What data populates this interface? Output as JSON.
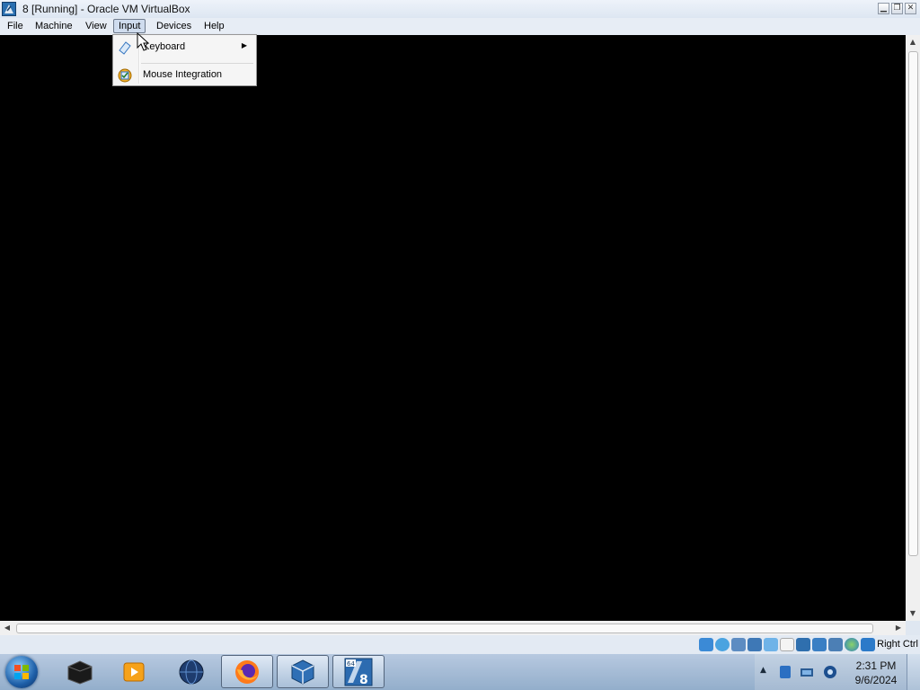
{
  "window": {
    "title": "8 [Running] - Oracle VM VirtualBox",
    "minimize_glyph": "▁",
    "restore_glyph": "❐",
    "close_glyph": "✕"
  },
  "menubar": {
    "items": [
      {
        "label": "File"
      },
      {
        "label": "Machine"
      },
      {
        "label": "View"
      },
      {
        "label": "Input",
        "active": true
      },
      {
        "label": "Devices"
      },
      {
        "label": "Help"
      }
    ]
  },
  "input_menu": {
    "items": [
      {
        "label": "Keyboard",
        "icon": "keyboard-icon",
        "has_submenu": true,
        "submenu_glyph": "▶"
      },
      {
        "label": "Mouse Integration",
        "icon": "mouse-integration-icon",
        "has_submenu": false
      }
    ]
  },
  "statusbar": {
    "host_key": "Right Ctrl",
    "icons": [
      "hard-disk-icon",
      "optical-drive-icon",
      "audio-icon",
      "network-icon",
      "usb-icon",
      "shared-folders-icon",
      "display-icon",
      "video-capture-icon",
      "cpu-icon",
      "mouse-integration-icon",
      "host-key-icon"
    ]
  },
  "scroll_glyphs": {
    "up": "▲",
    "down": "▼",
    "left": "◀",
    "right": "▶"
  },
  "taskbar": {
    "apps": [
      "start-button",
      "taskbar-app-explorer-dark",
      "taskbar-app-media",
      "taskbar-app-globe",
      "taskbar-app-firefox",
      "taskbar-app-virtualbox",
      "taskbar-app-vm-8"
    ],
    "vm_badge": "8",
    "vm_badge_small": "64"
  },
  "tray": {
    "arrow": "▲",
    "time": "2:31 PM",
    "date": "9/6/2024"
  },
  "colors": {
    "vm_screen": "#000000",
    "menu_active": "#cfdcee",
    "taskbar": "#a9bfd8"
  }
}
